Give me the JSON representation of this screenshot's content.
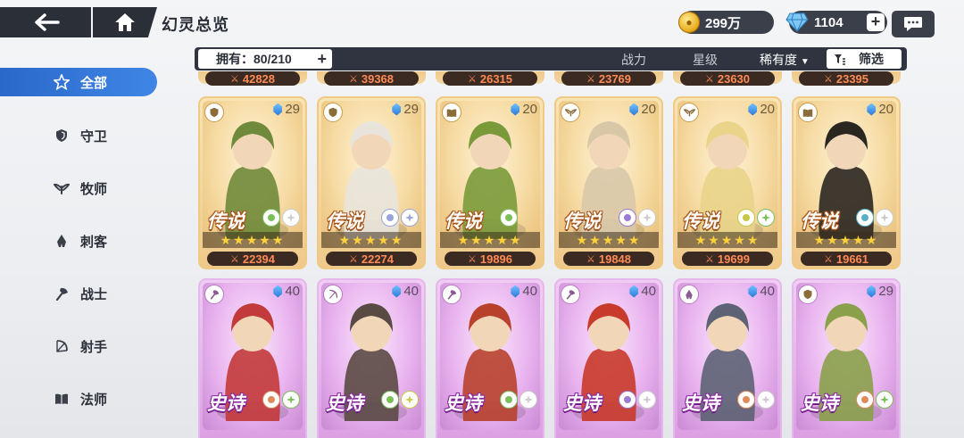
{
  "header": {
    "title": "幻灵总览",
    "gold": "299万",
    "gems": "1104"
  },
  "sidebar": {
    "items": [
      {
        "label": "全部",
        "icon": "star-outline-icon",
        "active": true
      },
      {
        "label": "守卫",
        "icon": "shield-icon"
      },
      {
        "label": "牧师",
        "icon": "wings-icon"
      },
      {
        "label": "刺客",
        "icon": "flame-icon"
      },
      {
        "label": "战士",
        "icon": "axe-icon"
      },
      {
        "label": "射手",
        "icon": "bow-icon"
      },
      {
        "label": "法师",
        "icon": "book-icon"
      }
    ]
  },
  "filterbar": {
    "owned": "拥有：80/210",
    "sort_power": "战力",
    "sort_star": "星级",
    "sort_rarity": "稀有度",
    "filter": "筛选"
  },
  "top_row_powers": [
    "42828",
    "39368",
    "26315",
    "23769",
    "23630",
    "23395"
  ],
  "cards": [
    {
      "rarity": "传说",
      "type": "leg",
      "level": "29",
      "power": "22394",
      "class": "guard"
    },
    {
      "rarity": "传说",
      "type": "leg",
      "level": "29",
      "power": "22274",
      "class": "guard"
    },
    {
      "rarity": "传说",
      "type": "leg",
      "level": "20",
      "power": "19896",
      "class": "mage"
    },
    {
      "rarity": "传说",
      "type": "leg",
      "level": "20",
      "power": "19848",
      "class": "priest"
    },
    {
      "rarity": "传说",
      "type": "leg",
      "level": "20",
      "power": "19699",
      "class": "priest"
    },
    {
      "rarity": "传说",
      "type": "leg",
      "level": "20",
      "power": "19661",
      "class": "mage"
    },
    {
      "rarity": "史诗",
      "type": "epic",
      "level": "40",
      "class": "warrior"
    },
    {
      "rarity": "史诗",
      "type": "epic",
      "level": "40",
      "class": "archer"
    },
    {
      "rarity": "史诗",
      "type": "epic",
      "level": "40",
      "class": "warrior"
    },
    {
      "rarity": "史诗",
      "type": "epic",
      "level": "40",
      "class": "warrior"
    },
    {
      "rarity": "史诗",
      "type": "epic",
      "level": "40",
      "class": "assassin"
    },
    {
      "rarity": "史诗",
      "type": "epic",
      "level": "29",
      "class": "guard"
    }
  ],
  "colors": {
    "accent": "#2f6fd1",
    "legend": "#efc98a",
    "epic": "#d99be0",
    "power": "#ff8a55"
  }
}
